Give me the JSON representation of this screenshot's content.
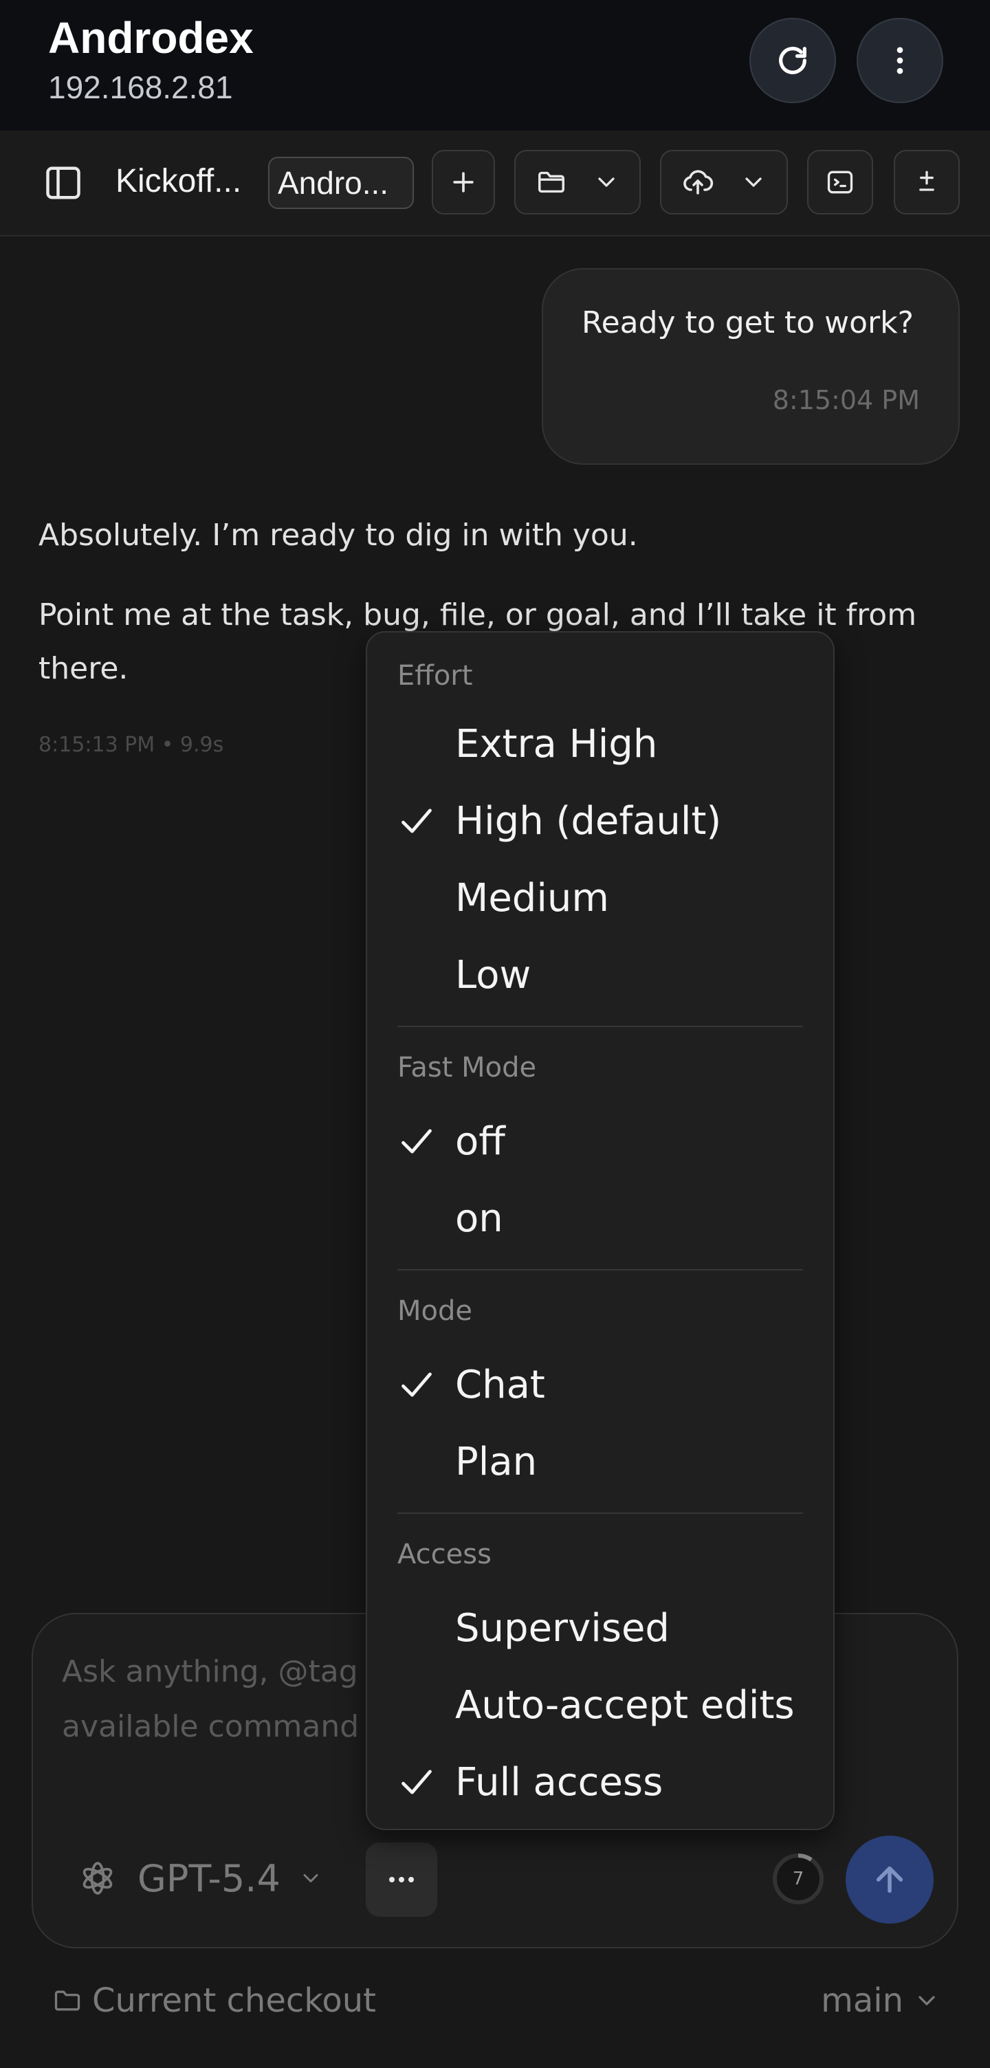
{
  "header": {
    "title": "Androdex",
    "subtitle": "192.168.2.81",
    "refresh_icon": "refresh-icon",
    "menu_icon": "more-vertical-icon"
  },
  "toolbar": {
    "thread_title": "Kickoff...",
    "project_chip": "Andro...",
    "icons": [
      "sidebar-toggle-icon",
      "plus-icon",
      "folder-icon",
      "chevron-down-icon",
      "cloud-upload-icon",
      "terminal-icon",
      "plus-minus-icon"
    ]
  },
  "chat": {
    "user_message": "Ready to get to work?",
    "user_time": "8:15:04 PM",
    "assistant_line1": "Absolutely. I’m ready to dig in with you.",
    "assistant_line2a": "Point me at the task, bug, file, or goal, and I’ll take it from",
    "assistant_line2b": "there.",
    "assistant_meta": "8:15:13 PM • 9.9s"
  },
  "composer": {
    "placeholder_line1": "Ask anything, @tag",
    "placeholder_line2": "available command",
    "model": "GPT-5.4",
    "context_count": "7",
    "more_icon": "more-horizontal-icon",
    "send_icon": "arrow-up-icon"
  },
  "footer": {
    "checkout": "Current checkout",
    "branch": "main"
  },
  "menu": {
    "effort_header": "Effort",
    "effort_items": [
      "Extra High",
      "High (default)",
      "Medium",
      "Low"
    ],
    "effort_selected": "High (default)",
    "fast_header": "Fast Mode",
    "fast_items": [
      "off",
      "on"
    ],
    "fast_selected": "off",
    "mode_header": "Mode",
    "mode_items": [
      "Chat",
      "Plan"
    ],
    "mode_selected": "Chat",
    "access_header": "Access",
    "access_items": [
      "Supervised",
      "Auto-accept edits",
      "Full access"
    ],
    "access_selected": "Full access"
  },
  "colors": {
    "background": "#181818",
    "header": "#0c0e12",
    "send_button": "#2a3e78"
  }
}
